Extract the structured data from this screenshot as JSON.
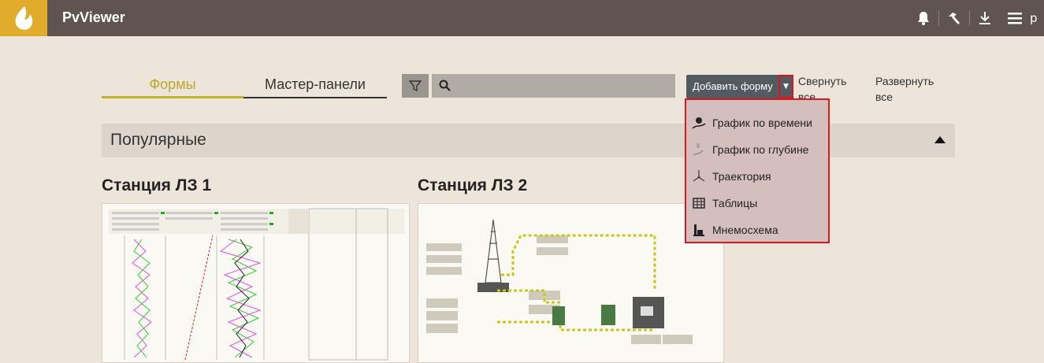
{
  "app": {
    "title": "PvViewer",
    "user_initial": "p"
  },
  "colors": {
    "topbar": "#5f5450",
    "logo": "#e1ac2c",
    "accent": "#c2b32a",
    "background": "#ede4da",
    "dropdown_border": "#d61a1f"
  },
  "icons": {
    "logo": "flame-logo",
    "top": [
      "bell-icon",
      "hammer-icon",
      "download-icon",
      "menu-icon"
    ]
  },
  "tabs": [
    {
      "label": "Формы",
      "active": true
    },
    {
      "label": "Мастер-панели",
      "active": false
    }
  ],
  "search": {
    "value": "",
    "placeholder": ""
  },
  "toolbar": {
    "add_form_label": "Добавить форму",
    "collapse_all_label": "Свернуть все",
    "expand_all_label": "Развернуть все"
  },
  "dropdown": {
    "items": [
      {
        "label": "График по времени",
        "icon": "time-chart-icon"
      },
      {
        "label": "График по глубине",
        "icon": "depth-chart-icon"
      },
      {
        "label": "Траектория",
        "icon": "trajectory-icon"
      },
      {
        "label": "Таблицы",
        "icon": "table-icon"
      },
      {
        "label": "Мнемосхема",
        "icon": "mnemonic-icon"
      }
    ]
  },
  "section": {
    "title": "Популярные",
    "expanded": true
  },
  "cards": [
    {
      "title": "Станция ЛЗ 1"
    },
    {
      "title": "Станция ЛЗ 2"
    }
  ]
}
